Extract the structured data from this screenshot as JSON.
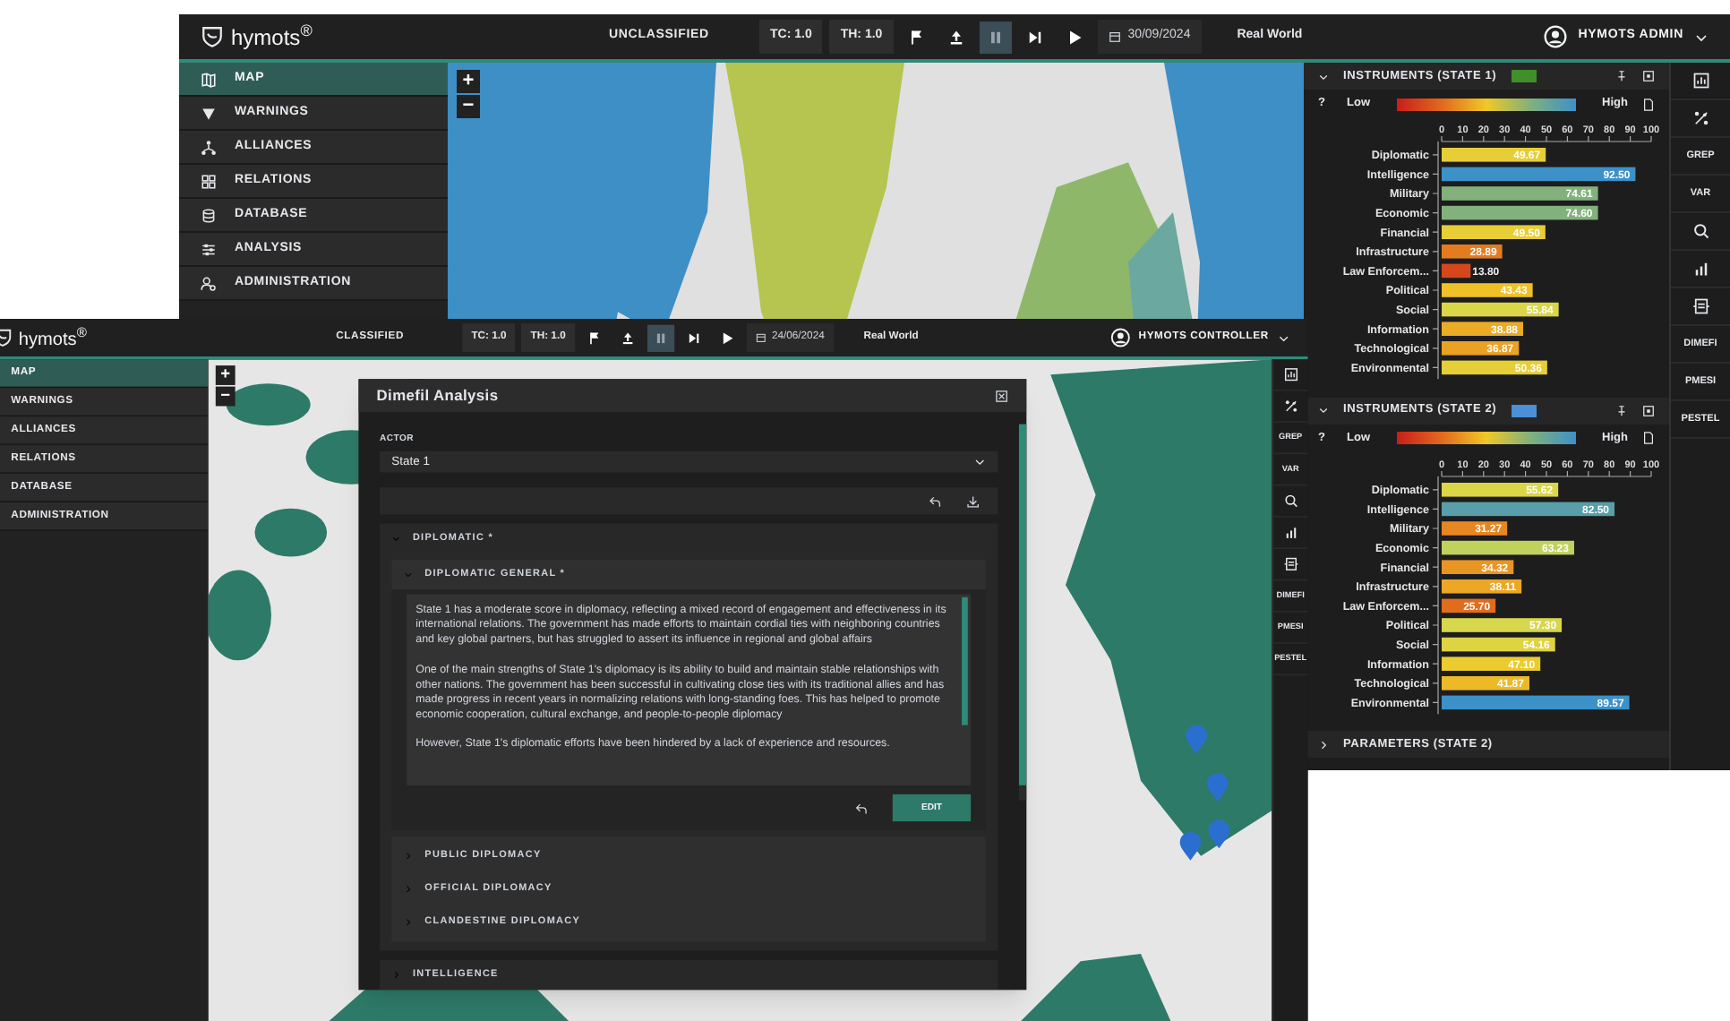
{
  "back_window": {
    "top_bar": {
      "logo": "hymots$^{®}$",
      "classification": "UNCLASSIFIED",
      "tc": "TC: 1.0",
      "th": "TH: 1.0",
      "playback_controls": [
        {
          "selected": false
        },
        {
          "selected": false
        },
        {
          "selected": true
        },
        {
          "selected": false
        },
        {
          "selected": false
        }
      ],
      "date": "30/09/2024",
      "world": "Real World",
      "user": "HYMOTS ADMIN"
    },
    "sidebar": {
      "items": [
        {
          "label": "MAP",
          "selected": true
        },
        {
          "label": "WARNINGS",
          "selected": false
        },
        {
          "label": "ALLIANCES",
          "selected": false
        },
        {
          "label": "RELATIONS",
          "selected": false
        },
        {
          "label": "DATABASE",
          "selected": false
        },
        {
          "label": "ANALYSIS",
          "selected": false
        },
        {
          "label": "ADMINISTRATION",
          "selected": false
        }
      ]
    },
    "map": {
      "kind": "picture",
      "zoom_in": "+",
      "zoom_out": "−"
    },
    "panels": [
      {
        "title": "INSTRUMENTS (STATE 1)",
        "color": "#3f8f2a",
        "expanded": true,
        "legend": {
          "help": "?",
          "low": "Low",
          "high": "High"
        },
        "chart_data": {
          "type": "bar",
          "orientation": "horizontal",
          "categories": [
            "Diplomatic",
            "Intelligence",
            "Military",
            "Economic",
            "Financial",
            "Infrastructure",
            "Law Enforcem...",
            "Political",
            "Social",
            "Information",
            "Technological",
            "Environmental"
          ],
          "series": [
            {
              "values": [
                49.67,
                92.5,
                74.61,
                74.6,
                49.5,
                28.89,
                13.8,
                43.43,
                55.84,
                38.88,
                36.87,
                50.36
              ]
            }
          ],
          "xlim": [
            0,
            100
          ],
          "xticks": [
            0,
            10,
            20,
            30,
            40,
            50,
            60,
            70,
            80,
            90,
            100
          ],
          "value_labels": [
            "49.67",
            "92.50",
            "74.61",
            "74.60",
            "49.50",
            "28.89",
            "13.80",
            "43.43",
            "55.84",
            "38.88",
            "36.87",
            "50.36"
          ]
        }
      },
      {
        "title": "INSTRUMENTS (STATE 2)",
        "color": "#4a8fd8",
        "expanded": true,
        "legend": {
          "help": "?",
          "low": "Low",
          "high": "High"
        },
        "chart_data": {
          "type": "bar",
          "orientation": "horizontal",
          "categories": [
            "Diplomatic",
            "Intelligence",
            "Military",
            "Economic",
            "Financial",
            "Infrastructure",
            "Law Enforcem...",
            "Political",
            "Social",
            "Information",
            "Technological",
            "Environmental"
          ],
          "series": [
            {
              "values": [
                55.62,
                82.5,
                31.27,
                63.23,
                34.32,
                38.11,
                25.7,
                57.3,
                54.16,
                47.1,
                41.87,
                89.57
              ]
            }
          ],
          "xlim": [
            0,
            100
          ],
          "xticks": [
            0,
            10,
            20,
            30,
            40,
            50,
            60,
            70,
            80,
            90,
            100
          ],
          "value_labels": [
            "55.62",
            "82.50",
            "31.27",
            "63.23",
            "34.32",
            "38.11",
            "25.70",
            "57.30",
            "54.16",
            "47.10",
            "41.87",
            "89.57"
          ]
        }
      },
      {
        "title": "PARAMETERS (STATE 2)",
        "expanded": false
      }
    ],
    "tool_strip": [
      {
        "kind": "icon"
      },
      {
        "kind": "icon"
      },
      {
        "kind": "label",
        "label": "GREP"
      },
      {
        "kind": "label",
        "label": "VAR"
      },
      {
        "kind": "icon"
      },
      {
        "kind": "icon"
      },
      {
        "kind": "icon"
      },
      {
        "kind": "label",
        "label": "DIMEFI"
      },
      {
        "kind": "label",
        "label": "PMESI"
      },
      {
        "kind": "label",
        "label": "PESTEL"
      }
    ]
  },
  "front_window": {
    "top_bar": {
      "logo": "hymots$^{®}$",
      "classification": "CLASSIFIED",
      "tc": "TC: 1.0",
      "th": "TH: 1.0",
      "playback_controls": [
        {
          "selected": false
        },
        {
          "selected": false
        },
        {
          "selected": true
        },
        {
          "selected": false
        },
        {
          "selected": false
        }
      ],
      "date": "24/06/2024",
      "world": "Real World",
      "user": "HYMOTS CONTROLLER"
    },
    "sidebar": {
      "items": [
        {
          "label": "MAP",
          "selected": true
        },
        {
          "label": "WARNINGS",
          "selected": false
        },
        {
          "label": "ALLIANCES",
          "selected": false
        },
        {
          "label": "RELATIONS",
          "selected": false
        },
        {
          "label": "DATABASE",
          "selected": false
        },
        {
          "label": "ADMINISTRATION",
          "selected": false
        }
      ]
    },
    "map": {
      "kind": "picture",
      "zoom_in": "+",
      "zoom_out": "−"
    },
    "dialog": {
      "title": "Dimefil Analysis",
      "actor_label": "ACTOR",
      "actor": "State 1",
      "sections": [
        {
          "label": "DIPLOMATIC *",
          "expanded": true,
          "subsections": [
            {
              "label": "DIPLOMATIC GENERAL *",
              "expanded": true,
              "paragraphs": [
                "State 1 has a moderate score in diplomacy, reflecting a mixed record of engagement and effectiveness in its international relations. The government has made efforts to maintain cordial ties with neighboring countries and key global partners, but has struggled to assert its influence in regional and global affairs",
                "One of the main strengths of State 1's diplomacy is its ability to build and maintain stable relationships with other nations. The government has been successful in cultivating close ties with its traditional allies and has made progress in recent years in normalizing relations with long-standing foes. This has helped to promote economic cooperation, cultural exchange, and people-to-people diplomacy",
                "However, State 1's diplomatic efforts have been hindered by a lack of experience and resources."
              ],
              "edit_button": "EDIT"
            },
            {
              "label": "PUBLIC DIPLOMACY",
              "expanded": false
            },
            {
              "label": "OFFICIAL DIPLOMACY",
              "expanded": false
            },
            {
              "label": "CLANDESTINE DIPLOMACY",
              "expanded": false
            }
          ]
        },
        {
          "label": "INTELLIGENCE",
          "expanded": false
        }
      ]
    },
    "tool_strip": [
      {
        "kind": "icon"
      },
      {
        "kind": "icon"
      },
      {
        "kind": "label",
        "label": "GREP"
      },
      {
        "kind": "label",
        "label": "VAR"
      },
      {
        "kind": "icon"
      },
      {
        "kind": "icon"
      },
      {
        "kind": "icon"
      },
      {
        "kind": "label",
        "label": "DIMEFI"
      },
      {
        "kind": "label",
        "label": "PMESI"
      },
      {
        "kind": "label",
        "label": "PESTEL"
      }
    ]
  }
}
